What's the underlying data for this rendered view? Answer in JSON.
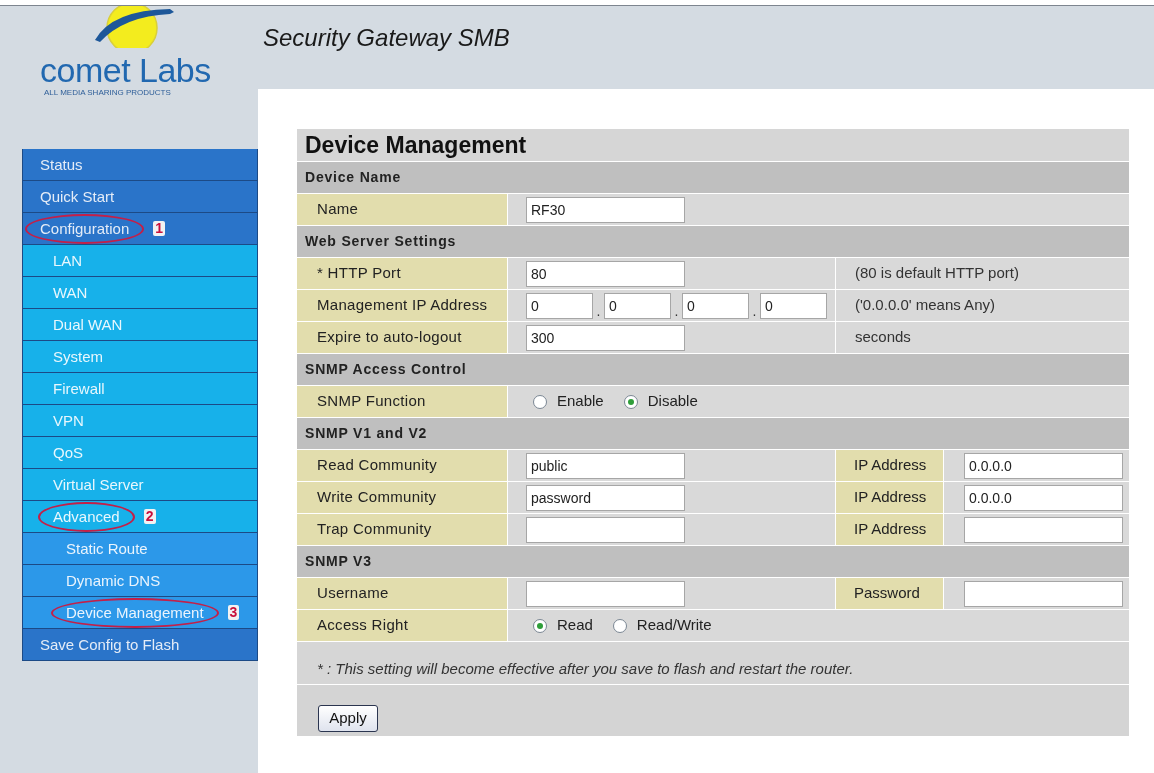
{
  "header": {
    "logo": {
      "wordmark": "comet Labs",
      "tagline": "ALL MEDIA SHARING PRODUCTS"
    },
    "title": "Security Gateway SMB"
  },
  "sidebar": {
    "items": [
      {
        "label": "Status"
      },
      {
        "label": "Quick Start"
      },
      {
        "label": "Configuration",
        "annotation": "1",
        "children": [
          {
            "label": "LAN"
          },
          {
            "label": "WAN"
          },
          {
            "label": "Dual WAN"
          },
          {
            "label": "System"
          },
          {
            "label": "Firewall"
          },
          {
            "label": "VPN"
          },
          {
            "label": "QoS"
          },
          {
            "label": "Virtual Server"
          },
          {
            "label": "Advanced",
            "annotation": "2",
            "children": [
              {
                "label": "Static Route"
              },
              {
                "label": "Dynamic DNS"
              },
              {
                "label": "Device Management",
                "annotation": "3"
              }
            ]
          }
        ]
      },
      {
        "label": "Save Config to Flash"
      }
    ]
  },
  "page": {
    "title": "Device Management",
    "sections": [
      {
        "title": "Device Name",
        "rows": [
          {
            "kind": "text",
            "label": "Name",
            "value": "RF30"
          }
        ]
      },
      {
        "title": "Web Server Settings",
        "rows": [
          {
            "kind": "text",
            "label": "* HTTP Port",
            "value": "80",
            "note": "(80 is default HTTP port)"
          },
          {
            "kind": "ip",
            "label": "Management IP Address",
            "octets": [
              "0",
              "0",
              "0",
              "0"
            ],
            "separator": ".",
            "note": "('0.0.0.0' means Any)"
          },
          {
            "kind": "text",
            "label": "Expire to auto-logout",
            "value": "300",
            "note": "seconds"
          }
        ]
      },
      {
        "title": "SNMP Access Control",
        "rows": [
          {
            "kind": "radio",
            "label": "SNMP Function",
            "options": [
              {
                "label": "Enable",
                "selected": false
              },
              {
                "label": "Disable",
                "selected": true
              }
            ]
          }
        ]
      },
      {
        "title": "SNMP V1 and V2",
        "rows": [
          {
            "kind": "text",
            "label": "Read Community",
            "value": "public",
            "extra": {
              "label": "IP Address",
              "value": "0.0.0.0"
            }
          },
          {
            "kind": "text",
            "label": "Write Community",
            "value": "password",
            "extra": {
              "label": "IP Address",
              "value": "0.0.0.0"
            }
          },
          {
            "kind": "text",
            "label": "Trap Community",
            "extra": {
              "label": "IP Address"
            }
          }
        ]
      },
      {
        "title": "SNMP V3",
        "rows": [
          {
            "kind": "text",
            "label": "Username",
            "extra": {
              "label": "Password"
            }
          },
          {
            "kind": "radio",
            "label": "Access Right",
            "options": [
              {
                "label": "Read",
                "selected": true
              },
              {
                "label": "Read/Write",
                "selected": false
              }
            ]
          }
        ]
      }
    ],
    "footnote": "* : This setting will become effective after you save to flash and restart the router.",
    "apply_button": "Apply"
  }
}
